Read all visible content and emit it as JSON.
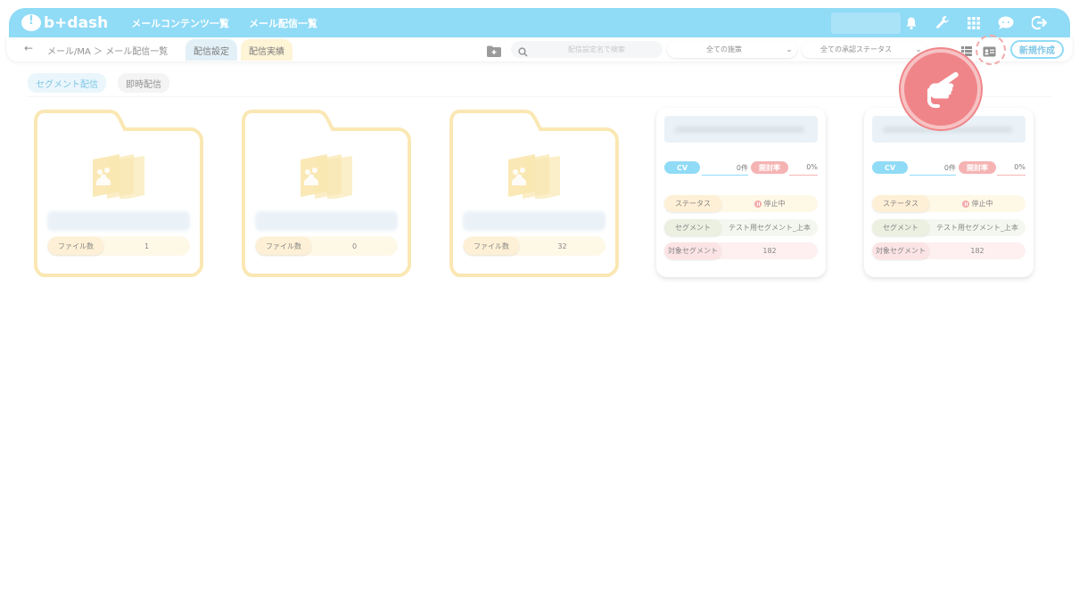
{
  "app": {
    "logo_text": "b+dash"
  },
  "topnav": {
    "items": [
      "メールコンテンツ一覧",
      "メール配信一覧"
    ]
  },
  "top_icons": [
    "bell-icon",
    "wrench-icon",
    "grid-icon",
    "chat-icon",
    "logout-icon"
  ],
  "subbar": {
    "breadcrumb": "メール/MA ＞ メール配信一覧",
    "tabs": [
      {
        "label": "配信設定",
        "active": true
      },
      {
        "label": "配信実績",
        "active": false
      }
    ],
    "search_placeholder": "配信設定名で検索",
    "filter_policy": "全ての施策",
    "filter_status": "全ての承認ステータス",
    "new_button": "新規作成"
  },
  "delivery_tabs": [
    "セグメント配信",
    "即時配信"
  ],
  "folders": [
    {
      "count_label": "ファイル数",
      "count": "1"
    },
    {
      "count_label": "ファイル数",
      "count": "0"
    },
    {
      "count_label": "ファイル数",
      "count": "32"
    }
  ],
  "cards": [
    {
      "cv_label": "CV",
      "cv_value": "0件",
      "open_label": "開封率",
      "open_value": "0%",
      "status_label": "ステータス",
      "status_value": "停止中",
      "segment_label": "セグメント",
      "segment_value": "テスト用セグメント_上本",
      "target_label": "対象セグメント",
      "target_value": "182"
    },
    {
      "cv_label": "CV",
      "cv_value": "0件",
      "open_label": "開封率",
      "open_value": "0%",
      "status_label": "ステータス",
      "status_value": "停止中",
      "segment_label": "セグメント",
      "segment_value": "テスト用セグメント_上本",
      "target_label": "対象セグメント",
      "target_value": "182"
    }
  ],
  "colors": {
    "primary": "#55c8f2",
    "folder": "#f7db8a",
    "accent_red": "#ef7b7b"
  }
}
